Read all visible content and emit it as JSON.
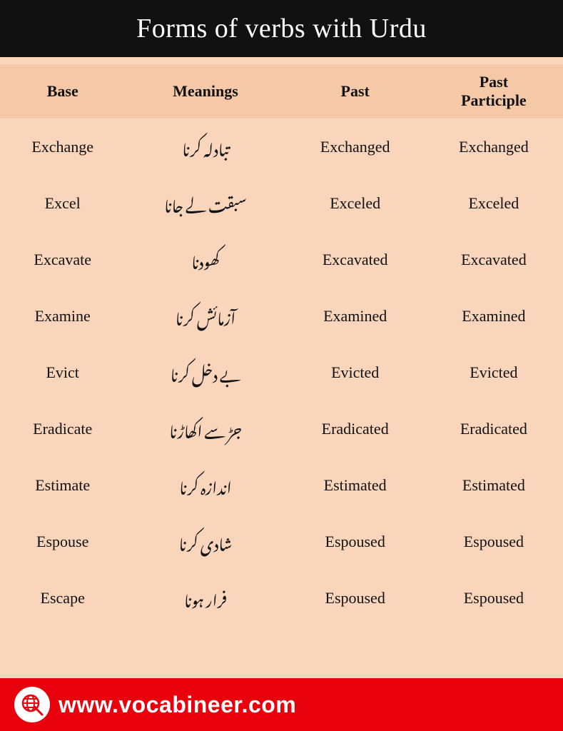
{
  "header": {
    "title": "Forms of verbs with Urdu"
  },
  "table": {
    "columns": [
      "Base",
      "Meanings",
      "Past",
      "Past\nParticiple"
    ],
    "rows": [
      {
        "base": "Exchange",
        "meaning": "تبادلہ کرنا",
        "past": "Exchanged",
        "past_participle": "Exchanged"
      },
      {
        "base": "Excel",
        "meaning": "سبقت لے جانا",
        "past": "Exceled",
        "past_participle": "Exceled"
      },
      {
        "base": "Excavate",
        "meaning": "کھودنا",
        "past": "Excavated",
        "past_participle": "Excavated"
      },
      {
        "base": "Examine",
        "meaning": "آزمائش کرنا",
        "past": "Examined",
        "past_participle": "Examined"
      },
      {
        "base": "Evict",
        "meaning": "بے دخل کرنا",
        "past": "Evicted",
        "past_participle": "Evicted"
      },
      {
        "base": "Eradicate",
        "meaning": "جڑ سے اکھاڑنا",
        "past": "Eradicated",
        "past_participle": "Eradicated"
      },
      {
        "base": "Estimate",
        "meaning": "اندازہ کرنا",
        "past": "Estimated",
        "past_participle": "Estimated"
      },
      {
        "base": "Espouse",
        "meaning": "شادی کرنا",
        "past": "Espoused",
        "past_participle": "Espoused"
      },
      {
        "base": "Escape",
        "meaning": "فرار ہونا",
        "past": "Espoused",
        "past_participle": "Espoused"
      }
    ]
  },
  "footer": {
    "url": "www.vocabineer.com"
  },
  "watermark": {
    "line1": "www.",
    "line2": "vocabineer",
    "line3": ".com"
  }
}
